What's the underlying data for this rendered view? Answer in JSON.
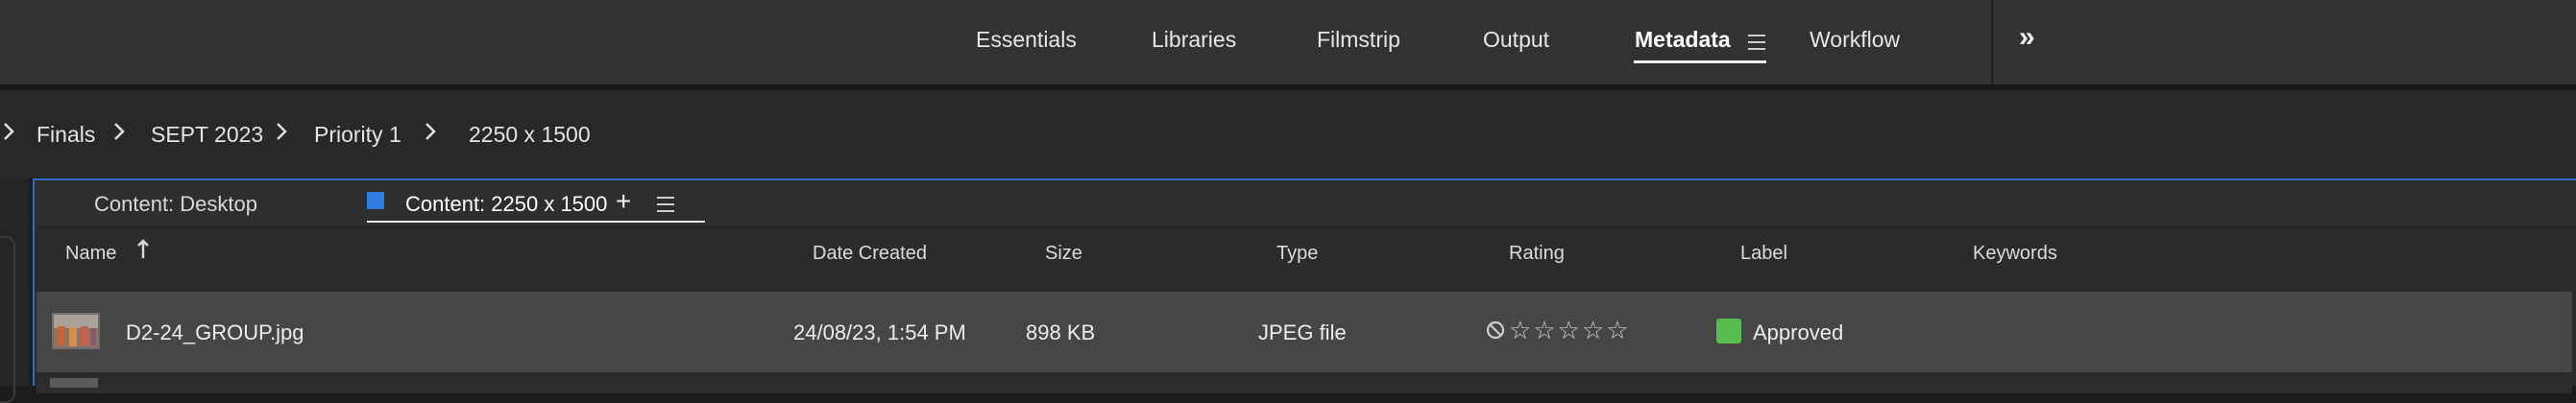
{
  "workspace": {
    "tabs": [
      "Essentials",
      "Libraries",
      "Filmstrip",
      "Output",
      "Metadata",
      "Workflow"
    ],
    "active_tab": "Metadata",
    "more_icon": "double-chevron-right-icon"
  },
  "breadcrumb": [
    "Finals",
    "SEPT 2023",
    "Priority 1",
    "2250 x 1500"
  ],
  "panel": {
    "tabs": [
      "Content: Desktop",
      "Content: 2250 x 1500"
    ],
    "active_tab": "Content: 2250 x 1500",
    "accent_color": "#2f7de0"
  },
  "columns": {
    "name": "Name",
    "date_created": "Date Created",
    "size": "Size",
    "type": "Type",
    "rating": "Rating",
    "label": "Label",
    "keywords": "Keywords"
  },
  "rows": [
    {
      "name": "D2-24_GROUP.jpg",
      "date_created": "24/08/23, 1:54 PM",
      "size": "898 KB",
      "type": "JPEG file",
      "rating_stars": 0,
      "label": "Approved",
      "label_color": "#59bc4e",
      "keywords": ""
    }
  ]
}
